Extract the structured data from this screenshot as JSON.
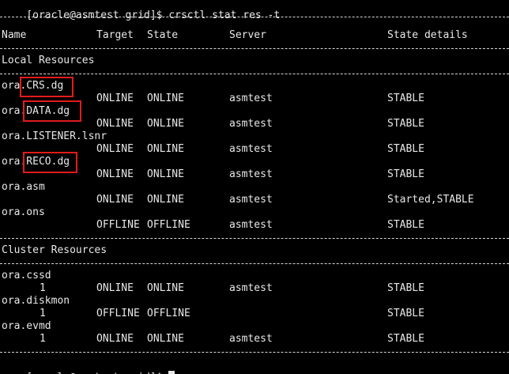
{
  "terminal": {
    "prompt": "[oracle@asmtest grid]$",
    "command": "crsctl stat res -t",
    "headers": {
      "name": "Name",
      "target": "Target",
      "state": "State",
      "server": "Server",
      "details": "State details"
    },
    "local_section": "Local Resources",
    "local_resources": [
      {
        "name": "ora.CRS.dg",
        "target": "ONLINE",
        "state": "ONLINE",
        "server": "asmtest",
        "details": "STABLE"
      },
      {
        "name": "ora.DATA.dg",
        "target": "ONLINE",
        "state": "ONLINE",
        "server": "asmtest",
        "details": "STABLE"
      },
      {
        "name": "ora.LISTENER.lsnr",
        "target": "ONLINE",
        "state": "ONLINE",
        "server": "asmtest",
        "details": "STABLE"
      },
      {
        "name": "ora.RECO.dg",
        "target": "ONLINE",
        "state": "ONLINE",
        "server": "asmtest",
        "details": "STABLE"
      },
      {
        "name": "ora.asm",
        "target": "ONLINE",
        "state": "ONLINE",
        "server": "asmtest",
        "details": "Started,STABLE"
      },
      {
        "name": "ora.ons",
        "target": "OFFLINE",
        "state": "OFFLINE",
        "server": "asmtest",
        "details": "STABLE"
      }
    ],
    "cluster_section": "Cluster Resources",
    "cluster_resources": [
      {
        "name": "ora.cssd",
        "num": "1",
        "target": "ONLINE",
        "state": "ONLINE",
        "server": "asmtest",
        "details": "STABLE"
      },
      {
        "name": "ora.diskmon",
        "num": "1",
        "target": "OFFLINE",
        "state": "OFFLINE",
        "server": "",
        "details": "STABLE"
      },
      {
        "name": "ora.evmd",
        "num": "1",
        "target": "ONLINE",
        "state": "ONLINE",
        "server": "asmtest",
        "details": "STABLE"
      }
    ],
    "highlight_color": "#e21b1b",
    "background": "#000000",
    "foreground": "#e8e8e8"
  }
}
